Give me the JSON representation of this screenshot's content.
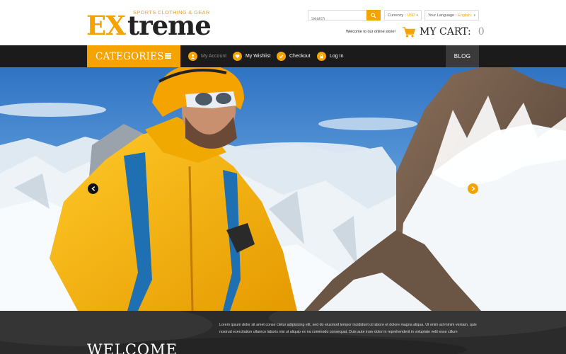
{
  "logo": {
    "part_accent": "EX",
    "part_main": "treme",
    "tagline": "SPORTS CLOTHING & GEAR"
  },
  "search": {
    "placeholder": "Search",
    "icon": "search-icon"
  },
  "currency": {
    "label": "Currency :",
    "value": "USD"
  },
  "language": {
    "label": "Your Language :",
    "value": "English"
  },
  "welcome_message": "Welcome to our online store!",
  "cart": {
    "label": "MY CART:",
    "count": "0",
    "icon": "shopping-cart-icon"
  },
  "nav": {
    "categories_label": "CATEGORIES",
    "links": [
      {
        "label": "My Account",
        "icon": "user-icon"
      },
      {
        "label": "My Wishlist",
        "icon": "heart-icon"
      },
      {
        "label": "Checkout",
        "icon": "checkmark-icon"
      },
      {
        "label": "Log In",
        "icon": "lock-icon"
      }
    ],
    "blog_label": "BLOG"
  },
  "hero": {
    "prev_icon": "chevron-left-icon",
    "next_icon": "chevron-right-icon"
  },
  "welcome": {
    "title": "WELCOME",
    "text": "Lorem ipsum dolor sit amet conse ctetur adipisicing elit, sed do eiusmod tempor incididunt ut labore et dolore magna aliqua. Ut enim ad minim veniam, quis nostrud exercitation ullamco laboris nisi ut aliquip ex ea commodo consequat. Duis aute irure dolor in reprehenderit in voluptate velit esse cillum"
  },
  "colors": {
    "accent": "#f5a300",
    "dark": "#1b1b1b",
    "blog_bg": "#3a3a3a"
  }
}
